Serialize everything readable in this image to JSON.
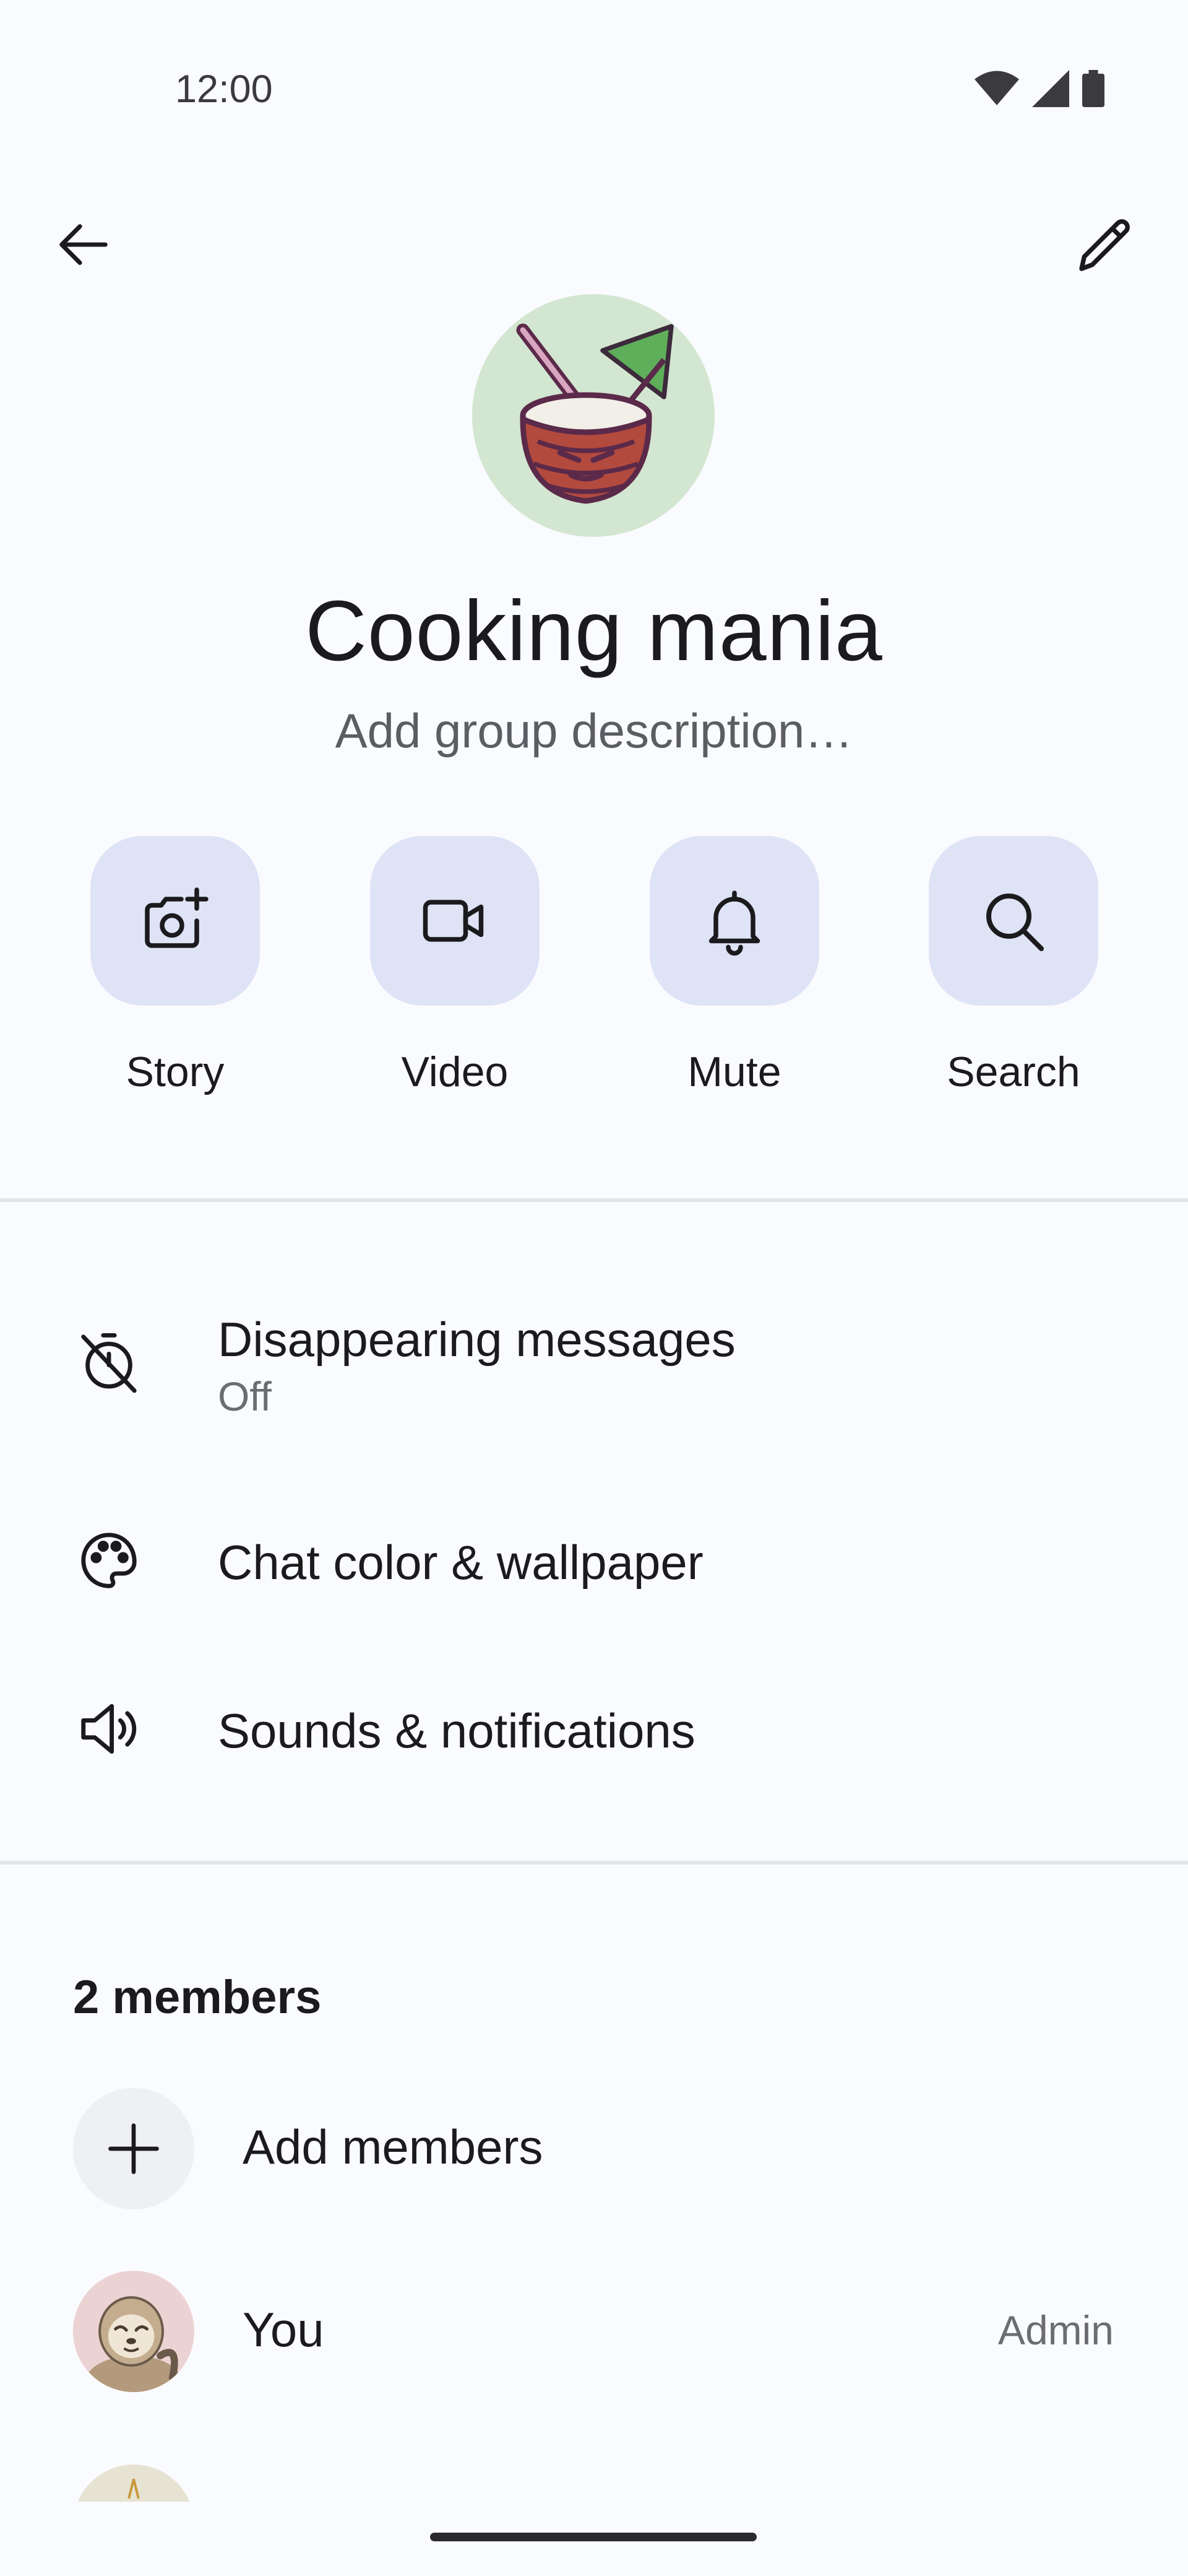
{
  "status_bar": {
    "time": "12:00"
  },
  "header": {
    "back_icon": "arrow-left-icon",
    "edit_icon": "pencil-icon"
  },
  "group": {
    "name": "Cooking mania",
    "description_placeholder": "Add group description…",
    "avatar_icon": "coconut-drink-icon",
    "avatar_bg": "#d3e6d1"
  },
  "actions": [
    {
      "label": "Story",
      "icon": "camera-add-icon"
    },
    {
      "label": "Video",
      "icon": "video-camera-icon"
    },
    {
      "label": "Mute",
      "icon": "bell-icon"
    },
    {
      "label": "Search",
      "icon": "search-icon"
    }
  ],
  "settings": {
    "disappearing": {
      "title": "Disappearing messages",
      "value": "Off",
      "icon": "timer-off-icon"
    },
    "chat_color": {
      "title": "Chat color & wallpaper",
      "icon": "palette-icon"
    },
    "sounds": {
      "title": "Sounds & notifications",
      "icon": "speaker-icon"
    }
  },
  "members": {
    "header": "2 members",
    "add_label": "Add members",
    "list": [
      {
        "name": "You",
        "role": "Admin",
        "avatar_icon": "sloth-avatar-icon"
      }
    ]
  },
  "colors": {
    "accent_tile": "#dfe3f6",
    "background": "#fafbfe"
  }
}
